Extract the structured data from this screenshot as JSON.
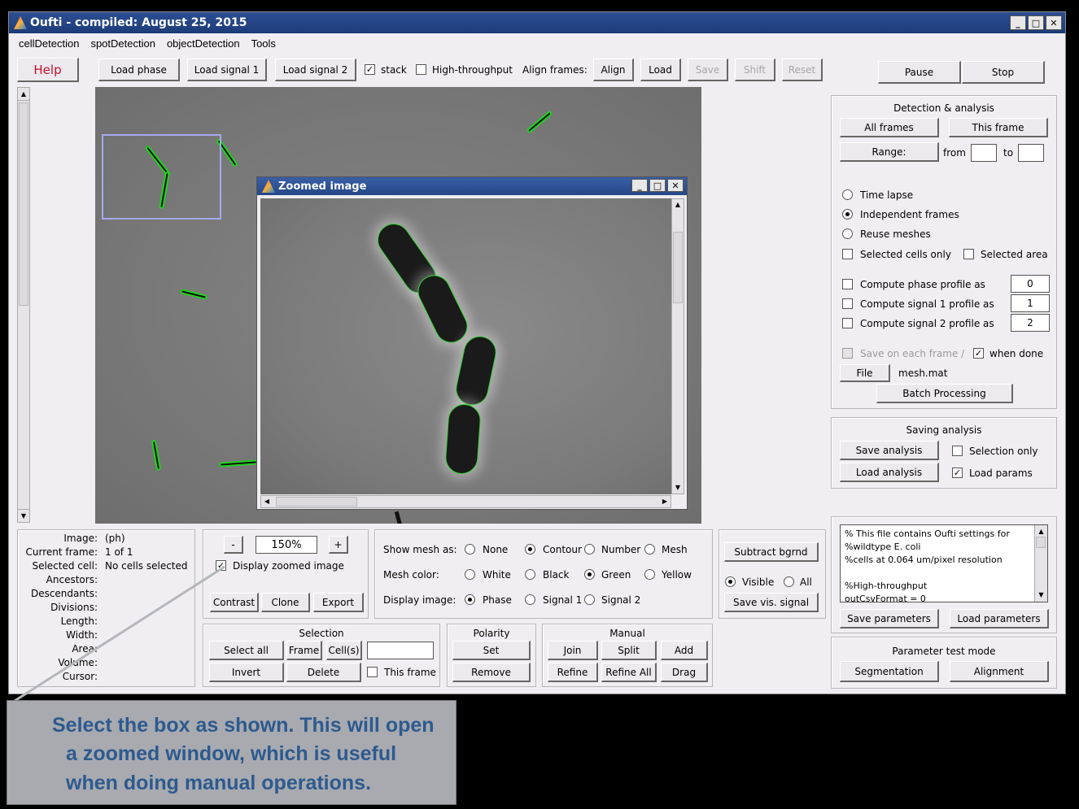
{
  "window": {
    "title": "Oufti - compiled:  August 25, 2015"
  },
  "menu": [
    "cellDetection",
    "spotDetection",
    "objectDetection",
    "Tools"
  ],
  "toolbar": {
    "help": "Help",
    "load_phase": "Load phase",
    "load_signal1": "Load signal 1",
    "load_signal2": "Load signal 2",
    "stack": "stack",
    "high_throughput": "High-throughput",
    "align_frames": "Align frames:",
    "align": "Align",
    "load": "Load",
    "save": "Save",
    "shift": "Shift",
    "reset": "Reset",
    "pause": "Pause",
    "stop": "Stop"
  },
  "zoom_window": {
    "title": "Zoomed image"
  },
  "detection": {
    "title": "Detection & analysis",
    "all_frames": "All frames",
    "this_frame": "This frame",
    "range": "Range:",
    "from": "from",
    "to": "to",
    "time_lapse": "Time lapse",
    "independent_frames": "Independent frames",
    "reuse_meshes": "Reuse meshes",
    "selected_cells_only": "Selected cells only",
    "selected_area": "Selected area",
    "phase_profile": "Compute phase profile as",
    "phase_val": "0",
    "signal1_profile": "Compute signal 1 profile as",
    "signal1_val": "1",
    "signal2_profile": "Compute signal 2 profile as",
    "signal2_val": "2",
    "save_each_frame": "Save on each frame /",
    "when_done": "when done",
    "file": "File",
    "filename": "mesh.mat",
    "batch": "Batch Processing"
  },
  "saving": {
    "title": "Saving analysis",
    "save_analysis": "Save analysis",
    "selection_only": "Selection only",
    "load_analysis": "Load analysis",
    "load_params": "Load params"
  },
  "params": {
    "text": [
      "% This file contains Oufti settings for",
      "%wildtype E. coli",
      "%cells at 0.064 um/pixel resolution",
      "",
      "%High-throughput",
      "outCsvFormat = 0"
    ],
    "save_parameters": "Save parameters",
    "load_parameters": "Load parameters",
    "test_mode": "Parameter test mode",
    "segmentation": "Segmentation",
    "alignment": "Alignment"
  },
  "info": {
    "labels": [
      "Image:",
      "Current frame:",
      "Selected cell:",
      "Ancestors:",
      "Descendants:",
      "Divisions:",
      "Length:",
      "Width:",
      "Area:",
      "Volume:",
      "Cursor:"
    ],
    "values": [
      "(ph)",
      "1 of 1",
      "No cells selected",
      "",
      "",
      "",
      "",
      "",
      "",
      "",
      ""
    ]
  },
  "zoom": {
    "minus": "-",
    "plus": "+",
    "value": "150%",
    "display_zoomed": "Display zoomed image",
    "contrast": "Contrast",
    "clone": "Clone",
    "export": "Export"
  },
  "mesh": {
    "show_as": "Show mesh as:",
    "none": "None",
    "contour": "Contour",
    "number": "Number",
    "mesh": "Mesh",
    "color": "Mesh color:",
    "white": "White",
    "black": "Black",
    "green": "Green",
    "yellow": "Yellow",
    "display_image": "Display image:",
    "phase": "Phase",
    "signal1": "Signal 1",
    "signal2": "Signal 2"
  },
  "background": {
    "subtract": "Subtract bgrnd",
    "visible": "Visible",
    "all": "All",
    "save_vis": "Save vis. signal"
  },
  "selection": {
    "title": "Selection",
    "select_all": "Select all",
    "frame": "Frame",
    "cells": "Cell(s)",
    "invert": "Invert",
    "delete": "Delete",
    "this_frame": "This frame"
  },
  "polarity": {
    "title": "Polarity",
    "set": "Set",
    "remove": "Remove"
  },
  "manual": {
    "title": "Manual",
    "join": "Join",
    "split": "Split",
    "add": "Add",
    "refine": "Refine",
    "refine_all": "Refine All",
    "drag": "Drag"
  },
  "callout": {
    "lines": [
      "Select the box as shown.  This will open",
      "a zoomed window, which is useful",
      "when doing manual operations."
    ]
  },
  "colors": {
    "title_bar": "#1d3b78",
    "contour": "#1ed41e",
    "callout_text": "#2d5a8e",
    "help_text": "#c8102e"
  }
}
